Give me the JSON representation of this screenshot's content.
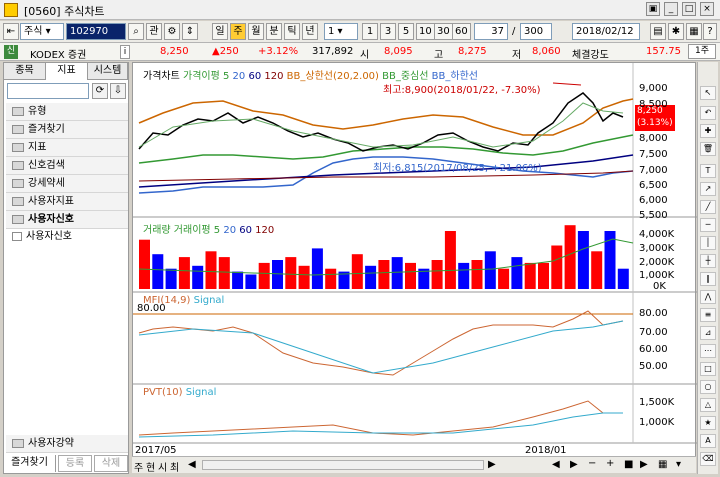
{
  "window": {
    "title": "[0560] 주식차트"
  },
  "toolbar": {
    "market": "주식",
    "code": "102970",
    "search": "⌕",
    "zoom_label": "관",
    "periods": [
      "일",
      "주",
      "월",
      "분",
      "틱",
      "년"
    ],
    "minute_selected": "1",
    "minute_presets": [
      "1",
      "3",
      "5",
      "10",
      "30",
      "60"
    ],
    "count_value": "37",
    "slash": "/",
    "total": "300",
    "date": "2018/02/12"
  },
  "quote": {
    "badge": "신",
    "name": "KODEX 증권",
    "info": "i",
    "price": "8,250",
    "change": "▲250",
    "pct": "+3.12%",
    "volume": "317,892",
    "open_label": "시",
    "open": "8,095",
    "high_label": "고",
    "high": "8,275",
    "low_label": "저",
    "low": "8,060",
    "strength_label": "체결강도",
    "strength": "157.75",
    "unit": "1주"
  },
  "left": {
    "tabs": [
      "종목",
      "지표",
      "시스템"
    ],
    "items": [
      "유형",
      "즐겨찾기",
      "지표",
      "신호검색",
      "강세약세",
      "사용자지표",
      "사용자신호"
    ],
    "subitem": "사용자신호",
    "bottom_item": "사용자강약",
    "bottom_tabs": [
      "즐겨찾기",
      "등록",
      "삭제"
    ]
  },
  "pane1": {
    "legend": [
      "가격차트",
      "가격이평 5",
      "20",
      "60",
      "120",
      "BB_상한선(20,2.00)",
      "BB_중심선",
      "BB_하한선"
    ],
    "high_note": "최고:8,900(2018/01/22, -7.30%)",
    "low_note": "최저:6,815(2017/08/25, +21.06%)",
    "price_tag": "8,250",
    "pct_tag": "(3.13%)",
    "yticks": [
      "9,000",
      "8,500",
      "8,000",
      "7,500",
      "7,000",
      "6,500",
      "6,000",
      "5,500"
    ]
  },
  "pane2": {
    "legend": [
      "거래량",
      "거래이평 5",
      "20",
      "60",
      "120"
    ],
    "yticks": [
      "4,000K",
      "3,000K",
      "2,000K",
      "1,000K",
      "0K"
    ]
  },
  "pane3": {
    "legend": [
      "MFI(14,9)",
      "Signal"
    ],
    "top_value": "80.00",
    "yticks": [
      "80.00",
      "70.00",
      "60.00",
      "50.00"
    ]
  },
  "pane4": {
    "legend": [
      "PVT(10)",
      "Signal"
    ],
    "yticks": [
      "1,500K",
      "1,000K"
    ]
  },
  "xaxis": {
    "labels": [
      "2017/05",
      "2018/01"
    ]
  },
  "bottombar": {
    "tabs": [
      "주",
      "현",
      "시",
      "최"
    ]
  },
  "colors": {
    "up": "#ff0000",
    "down": "#0000ff",
    "ma5": "#339933",
    "ma20": "#3366cc",
    "ma60": "#000080",
    "ma120": "#800000",
    "bb": "#cc6600"
  }
}
